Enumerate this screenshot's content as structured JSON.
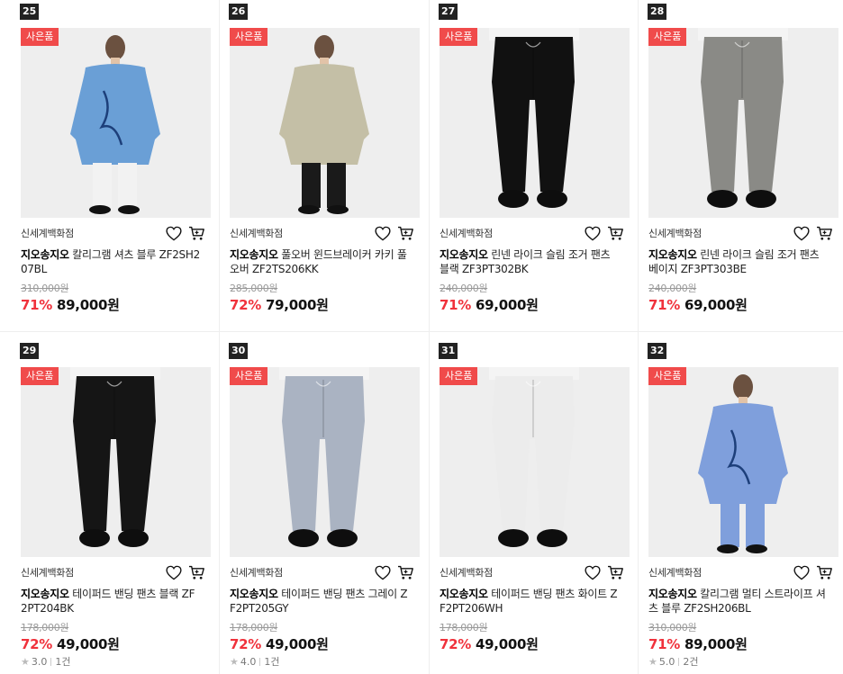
{
  "products": [
    {
      "rank": "25",
      "badge": "사은품",
      "seller": "신세계백화점",
      "brand": "지오송지오",
      "name": " 칼리그램 셔츠 블루 ZF2SH207BL",
      "original_price": "310,000원",
      "discount": "71%",
      "price": "89,000원",
      "image": "man-blue-shirt-back",
      "colors": {
        "top": "#6a9fd6",
        "bottom": "#f2f2f2"
      }
    },
    {
      "rank": "26",
      "badge": "사은품",
      "seller": "신세계백화점",
      "brand": "지오송지오",
      "name": " 풀오버 윈드브레이커 카키 풀오버 ZF2TS206KK",
      "original_price": "285,000원",
      "discount": "72%",
      "price": "79,000원",
      "image": "man-khaki-pullover",
      "colors": {
        "top": "#c4bfa6",
        "bottom": "#1a1a1a"
      }
    },
    {
      "rank": "27",
      "badge": "사은품",
      "seller": "신세계백화점",
      "brand": "지오송지오",
      "name": " 린넨 라이크 슬림 조거 팬츠 블랙 ZF3PT302BK",
      "original_price": "240,000원",
      "discount": "71%",
      "price": "69,000원",
      "image": "black-jogger-pants",
      "colors": {
        "top": "#111111",
        "bottom": "#111111"
      }
    },
    {
      "rank": "28",
      "badge": "사은품",
      "seller": "신세계백화점",
      "brand": "지오송지오",
      "name": " 린넨 라이크 슬림 조거 팬츠 베이지 ZF3PT303BE",
      "original_price": "240,000원",
      "discount": "71%",
      "price": "69,000원",
      "image": "gray-jogger-pants",
      "colors": {
        "top": "#8a8a86",
        "bottom": "#8a8a86"
      }
    },
    {
      "rank": "29",
      "badge": "사은품",
      "seller": "신세계백화점",
      "brand": "지오송지오",
      "name": " 테이퍼드 밴딩 팬츠 블랙 ZF2PT204BK",
      "original_price": "178,000원",
      "discount": "72%",
      "price": "49,000원",
      "image": "black-tapered-pants",
      "colors": {
        "top": "#151515",
        "bottom": "#151515"
      },
      "rating": "3.0",
      "reviews": "1건"
    },
    {
      "rank": "30",
      "badge": "사은품",
      "seller": "신세계백화점",
      "brand": "지오송지오",
      "name": " 테이퍼드 밴딩 팬츠 그레이 ZF2PT205GY",
      "original_price": "178,000원",
      "discount": "72%",
      "price": "49,000원",
      "image": "gray-striped-pants",
      "colors": {
        "top": "#aab3c2",
        "bottom": "#aab3c2"
      },
      "rating": "4.0",
      "reviews": "1건"
    },
    {
      "rank": "31",
      "badge": "사은품",
      "seller": "신세계백화점",
      "brand": "지오송지오",
      "name": " 테이퍼드 밴딩 팬츠 화이트 ZF2PT206WH",
      "original_price": "178,000원",
      "discount": "72%",
      "price": "49,000원",
      "image": "white-tapered-pants",
      "colors": {
        "top": "#ececec",
        "bottom": "#ececec"
      }
    },
    {
      "rank": "32",
      "badge": "사은품",
      "seller": "신세계백화점",
      "brand": "지오송지오",
      "name": " 칼리그램 멀티 스트라이프 셔츠 블루 ZF2SH206BL",
      "original_price": "310,000원",
      "discount": "71%",
      "price": "89,000원",
      "image": "man-blue-striped-shirt",
      "colors": {
        "top": "#7f9fdc",
        "bottom": "#7f9fdc"
      },
      "rating": "5.0",
      "reviews": "2건"
    }
  ],
  "icons": {
    "wishlist": "heart-icon",
    "cart": "cart-icon",
    "rating": "star-icon"
  }
}
